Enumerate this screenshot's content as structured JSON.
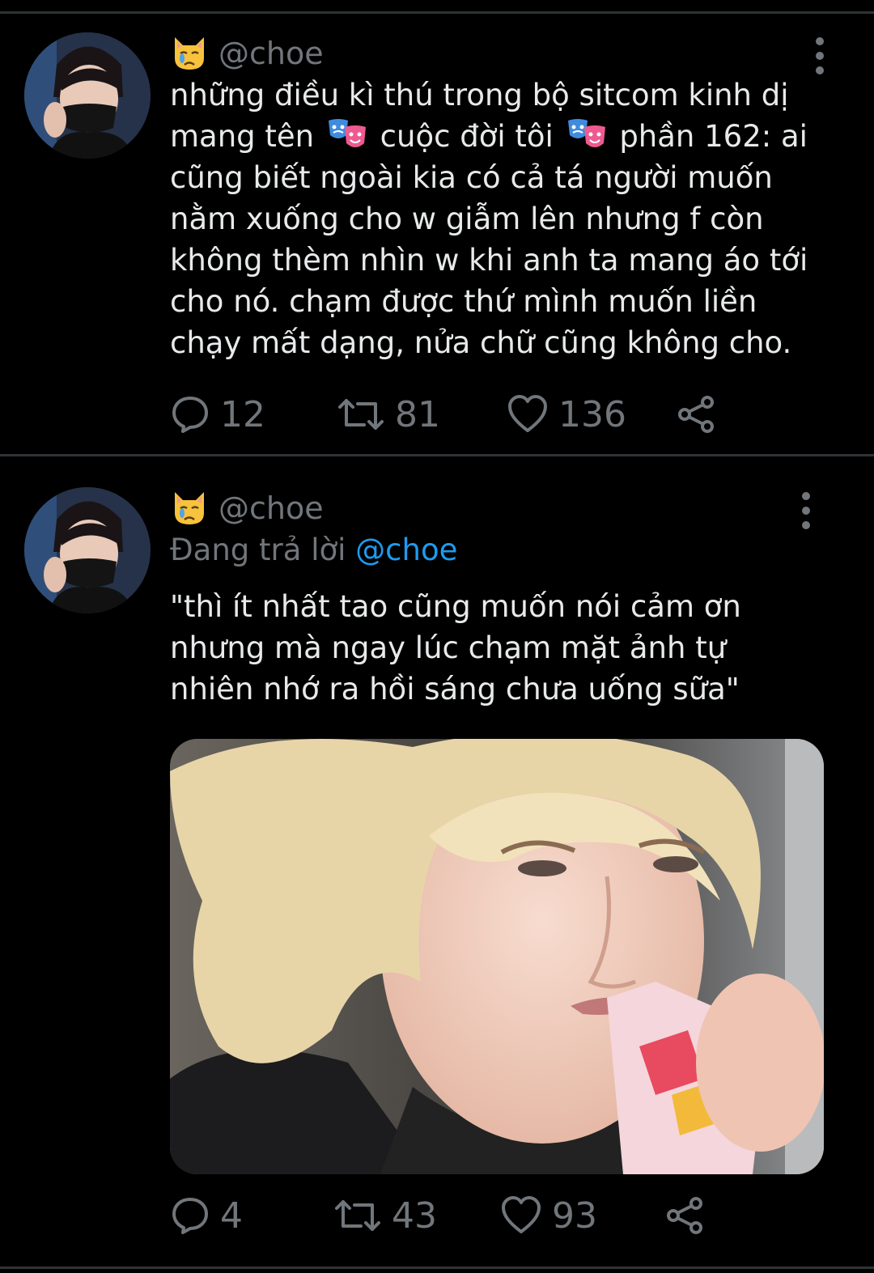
{
  "colors": {
    "background": "#000000",
    "text": "#e7e9ea",
    "muted": "#71767b",
    "accent": "#1d9bf0",
    "divider": "#2f3336"
  },
  "tweets": [
    {
      "emoji": "crying-cat-face",
      "handle": "@choe",
      "text_parts": [
        "những điều kì thú trong bộ sitcom kinh dị\nmang tên ",
        " cuộc đời tôi ",
        " phần 162: ai\ncũng biết ngoài kia có cả tá người muốn\nnằm xuống cho w giẫm lên nhưng f còn\nkhông thèm nhìn w khi anh ta mang áo tới\ncho nó. chạm được thứ mình muốn liền\nchạy mất dạng, nửa chữ cũng không cho."
      ],
      "inline_emoji": "performing-arts-masks",
      "actions": {
        "reply_count": "12",
        "retweet_count": "81",
        "like_count": "136"
      }
    },
    {
      "emoji": "crying-cat-face",
      "handle": "@choe",
      "reply_prefix": "Đang trả lời ",
      "reply_mention": "@choe",
      "text": "\"thì ít nhất tao cũng muốn nói cảm ơn\nnhưng mà ngay lúc chạm mặt ảnh tự\nnhiên nhớ ra hồi sáng chưa uống sữa\"",
      "media": "photo-blond-person-drinking-milk-carton",
      "actions": {
        "reply_count": "4",
        "retweet_count": "43",
        "like_count": "93"
      }
    }
  ]
}
